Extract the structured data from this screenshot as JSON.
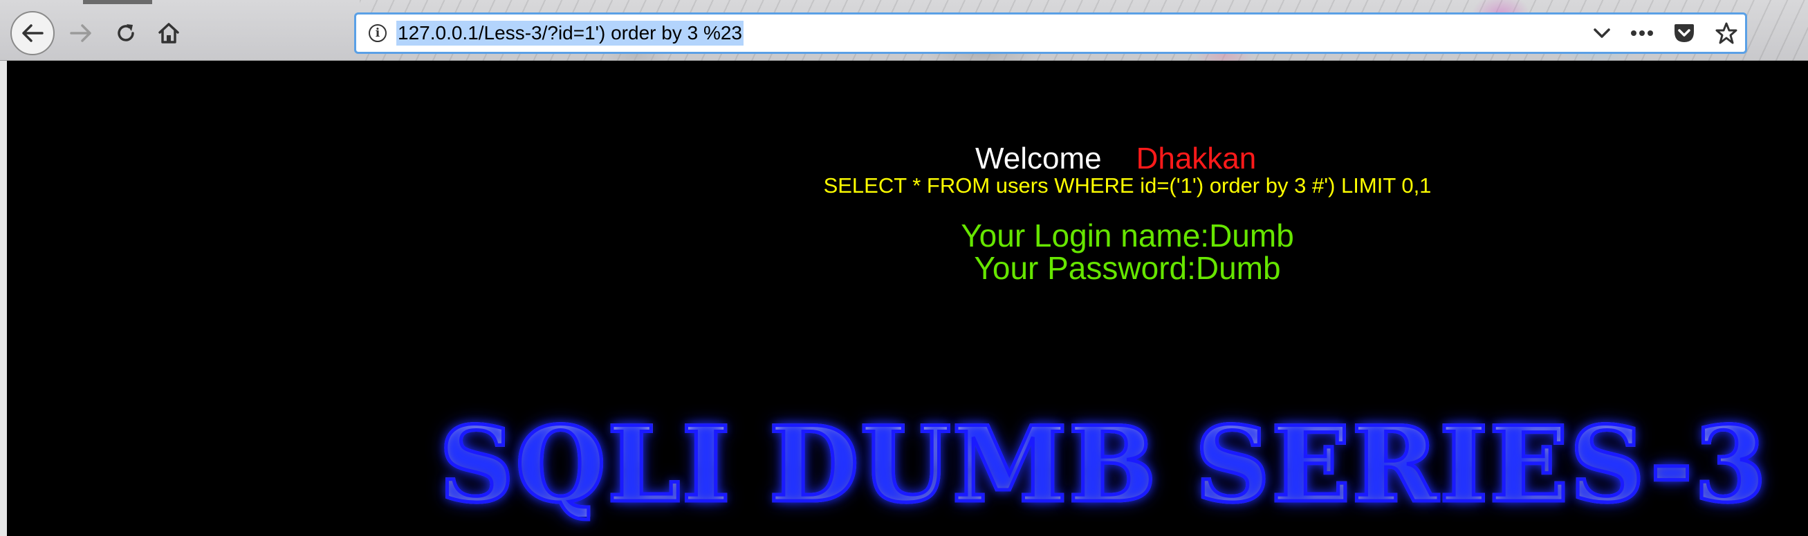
{
  "browser": {
    "url": "127.0.0.1/Less-3/?id=1') order by 3 %23",
    "icons": {
      "back": "back-arrow-icon",
      "forward": "forward-arrow-icon",
      "reload": "reload-icon",
      "home": "home-icon",
      "info": "info-icon",
      "dropdown": "chevron-down-icon",
      "more": "more-icon",
      "pocket": "pocket-icon",
      "bookmark": "star-icon"
    },
    "info_glyph": "i",
    "accent_color": "#5aa0e6"
  },
  "page": {
    "welcome_label": "Welcome",
    "user_name": "Dhakkan",
    "query": "SELECT * FROM users WHERE id=('1') order by 3 #') LIMIT 0,1",
    "login_name": "Your Login name:Dumb",
    "password": "Your Password:Dumb",
    "banner_title": "SQLI DUMB SERIES-3",
    "colors": {
      "background": "#000000",
      "welcome": "#ffffff",
      "user": "#ff1a1a",
      "query": "#ffff00",
      "result": "#66e600",
      "banner_glow": "#1a1aff"
    }
  }
}
